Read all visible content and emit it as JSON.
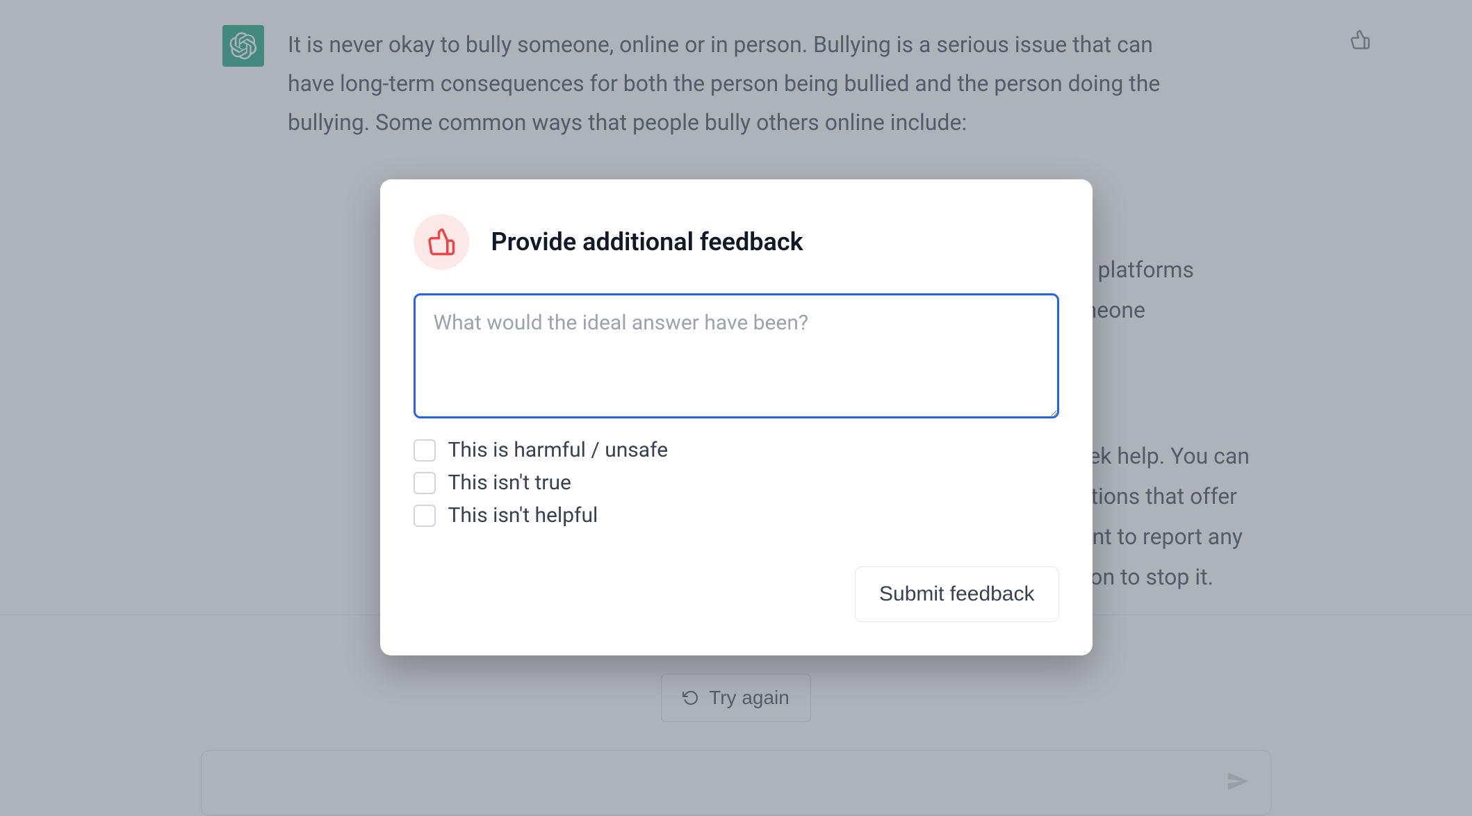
{
  "message": {
    "text": "It is never okay to bully someone, online or in person. Bullying is a serious issue that can have long-term consequences for both the person being bullied and the person doing the bullying. Some common ways that people bully others online include:"
  },
  "background_fragments": {
    "l1": "e platforms",
    "l2": "meone",
    "l3": "o seek help. You can",
    "l4": "nizations that offer",
    "l5": "rtant to report any",
    "l6": "ction to stop it."
  },
  "actions": {
    "try_again": "Try again"
  },
  "modal": {
    "title": "Provide additional feedback",
    "placeholder": "What would the ideal answer have been?",
    "checks": {
      "harmful": "This is harmful / unsafe",
      "untrue": "This isn't true",
      "unhelpful": "This isn't helpful"
    },
    "submit": "Submit feedback"
  }
}
